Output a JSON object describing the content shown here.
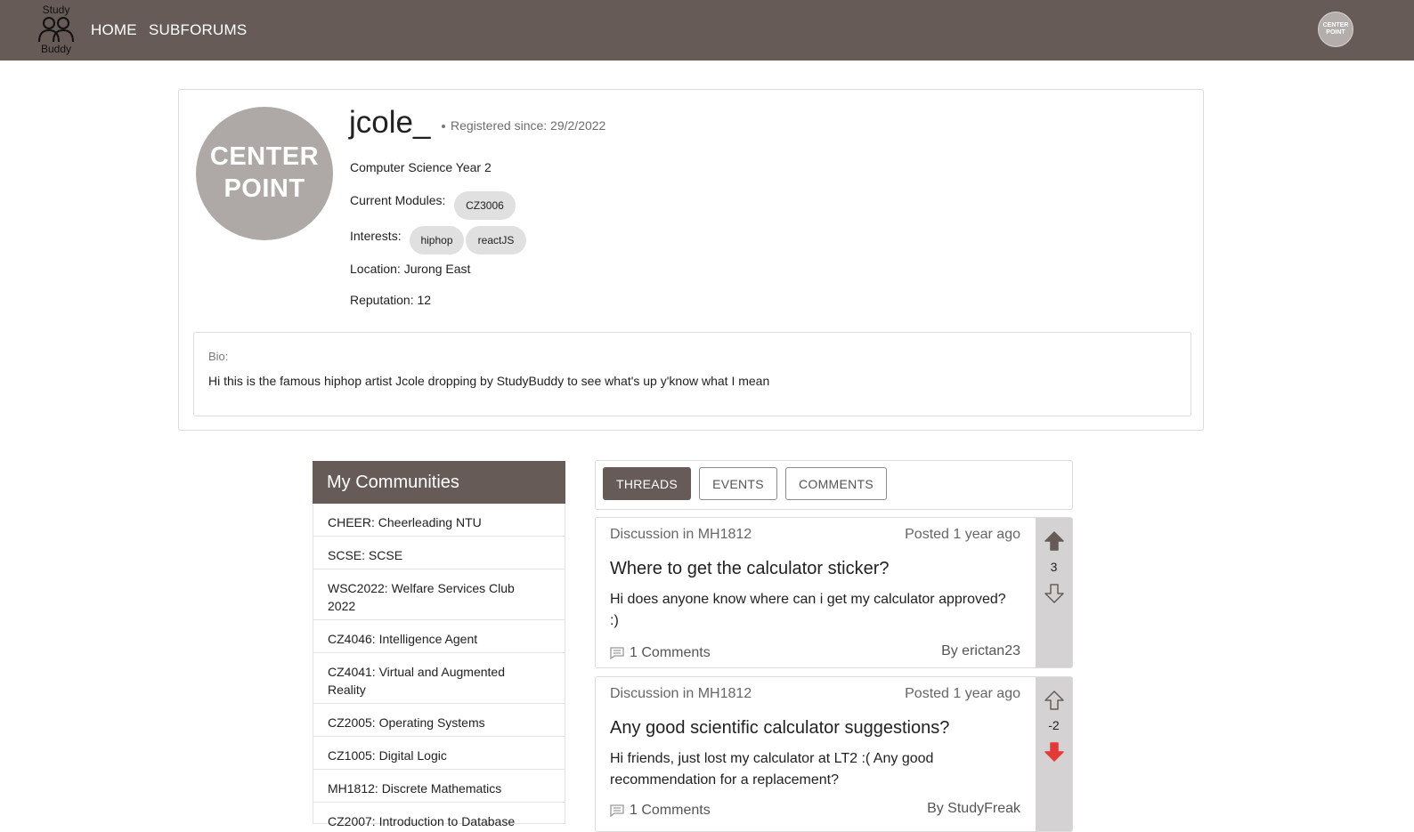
{
  "header": {
    "logo_top": "Study",
    "logo_bottom": "Buddy",
    "nav_home": "HOME",
    "nav_subforums": "SUBFORUMS",
    "avatar_text_1": "CENTER",
    "avatar_text_2": "POINT"
  },
  "profile": {
    "avatar_text_1": "CENTER",
    "avatar_text_2": "POINT",
    "username": "jcole_",
    "registered": "Registered since: 29/2/2022",
    "course": "Computer Science Year 2",
    "modules_label": "Current Modules:",
    "modules": [
      "CZ3006"
    ],
    "interests_label": "Interests:",
    "interests": [
      "hiphop",
      "reactJS"
    ],
    "location": "Location: Jurong East",
    "reputation": "Reputation: 12",
    "bio_label": "Bio:",
    "bio_text": "Hi this is the famous hiphop artist Jcole dropping by StudyBuddy to see what's up y'know what I mean"
  },
  "communities": {
    "title": "My Communities",
    "items": [
      "CHEER: Cheerleading NTU",
      "SCSE: SCSE",
      "WSC2022: Welfare Services Club 2022",
      "CZ4046: Intelligence Agent",
      "CZ4041: Virtual and Augmented Reality",
      "CZ2005: Operating Systems",
      "CZ1005: Digital Logic",
      "MH1812: Discrete Mathematics",
      "CZ2007: Introduction to Database"
    ]
  },
  "tabs": {
    "threads": "THREADS",
    "events": "EVENTS",
    "comments": "COMMENTS",
    "active": "threads"
  },
  "threads": [
    {
      "category": "Discussion in MH1812",
      "posted": "Posted 1 year ago",
      "title": "Where to get the calculator sticker?",
      "body": "Hi does anyone know where can i get my calculator approved? :)",
      "comments": "1 Comments",
      "author": "By erictan23",
      "votes": "3",
      "vote_state": "up"
    },
    {
      "category": "Discussion in MH1812",
      "posted": "Posted 1 year ago",
      "title": "Any good scientific calculator suggestions?",
      "body": "Hi friends, just lost my calculator at LT2 :( Any good recommendation for a replacement?",
      "comments": "1 Comments",
      "author": "By StudyFreak",
      "votes": "-2",
      "vote_state": "down"
    }
  ],
  "colors": {
    "header_bg": "#665b57",
    "upvote_active": "#665b57",
    "downvote_active": "#e53935",
    "vote_column_bg": "#d4d2d2"
  }
}
